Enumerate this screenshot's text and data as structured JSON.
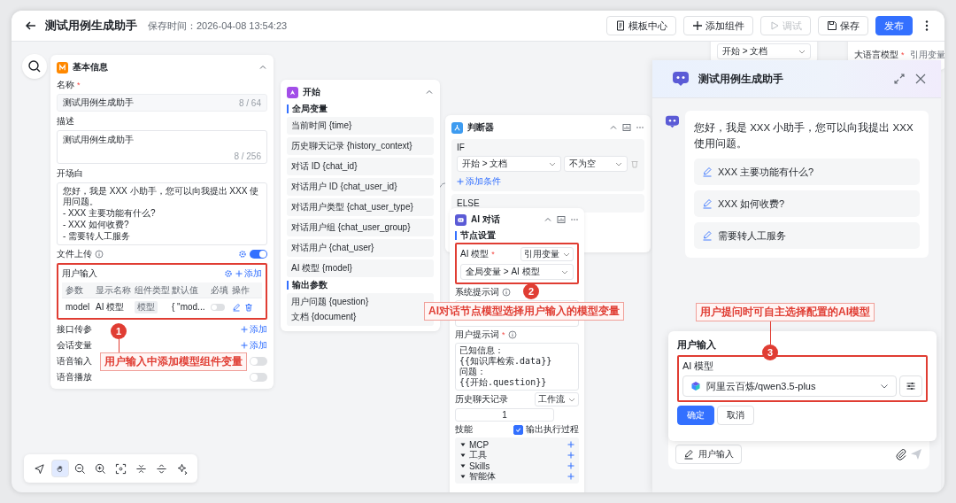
{
  "header": {
    "title": "测试用例生成助手",
    "save_time": "保存时间：2026-04-08 13:54:23",
    "buttons": [
      {
        "label": "模板中心",
        "kind": "default",
        "disabled": false
      },
      {
        "label": "添加组件",
        "kind": "default",
        "disabled": false
      },
      {
        "label": "调试",
        "kind": "default",
        "disabled": true
      },
      {
        "label": "保存",
        "kind": "default",
        "disabled": false
      },
      {
        "label": "发布",
        "kind": "primary",
        "disabled": false
      }
    ]
  },
  "base_info": {
    "title": "基本信息",
    "name": {
      "label": "名称",
      "required_mark": "*",
      "value": "测试用例生成助手",
      "count": "8 / 64"
    },
    "description": {
      "label": "描述",
      "value": "测试用例生成助手",
      "count": "8 / 256"
    },
    "opening": {
      "label": "开场白",
      "lines": [
        "您好，我是 XXX 小助手，您可以向我提出 XXX 使用问题。",
        "- XXX 主要功能有什么?",
        "- XXX 如何收费?",
        "- 需要转人工服务"
      ]
    },
    "file_upload": {
      "label": "文件上传",
      "on": true
    },
    "user_input": {
      "label": "用户输入",
      "add": "添加",
      "columns": [
        "参数",
        "显示名称",
        "组件类型",
        "默认值",
        "必填",
        "操作"
      ],
      "rows": [
        {
          "param": "model",
          "display_name": "AI 模型",
          "component_type": "模型",
          "default": "{ \"mod...",
          "required": false
        }
      ]
    },
    "settings": [
      {
        "kind": "add",
        "label": "接口传参",
        "action": "添加"
      },
      {
        "kind": "add",
        "label": "会话变量",
        "action": "添加"
      },
      {
        "kind": "toggle",
        "label": "语音输入",
        "on": false
      },
      {
        "kind": "toggle",
        "label": "语音播放",
        "on": false
      }
    ]
  },
  "start_node": {
    "title": "开始",
    "globals_label": "全局变量",
    "globals": [
      "当前时间 {time}",
      "历史聊天记录 {history_context}",
      "对话 ID {chat_id}",
      "对话用户 ID {chat_user_id}",
      "对话用户类型 {chat_user_type}",
      "对话用户组 {chat_user_group}",
      "对话用户 {chat_user}",
      "AI 模型 {model}"
    ],
    "outputs_label": "输出参数",
    "outputs": [
      "用户问题 {question}",
      "文档 {document}"
    ]
  },
  "judge_node": {
    "title": "判断器",
    "if_label": "IF",
    "field": "开始 > 文档",
    "operator": "不为空",
    "add_condition": "添加条件",
    "else_label": "ELSE"
  },
  "ai_node": {
    "title": "AI 对话",
    "section": "节点设置",
    "model_label": "AI 模型",
    "required_mark": "*",
    "model_mode": "引用变量",
    "model_value": "全局变量 > AI 模型",
    "system_prompt_label": "系统提示词",
    "user_prompt_label": "用户提示词",
    "user_prompt_lines": [
      "已知信息：",
      "{{知识库检索.data}}",
      "问题：",
      "{{开始.question}}"
    ],
    "history_label": "历史聊天记录",
    "history_mode": "工作流",
    "history_count": "1",
    "skills_label": "技能",
    "show_process": {
      "label": "输出执行过程",
      "checked": true
    },
    "skills": [
      "MCP",
      "工具",
      "Skills",
      "智能体"
    ]
  },
  "background_nodes": {
    "field": "开始 > 文档",
    "model_label": "大语言模型",
    "required_mark": "*",
    "model_mode": "引用变量"
  },
  "chat": {
    "title": "测试用例生成助手",
    "greeting": "您好，我是 XXX 小助手，您可以向我提出 XXX 使用问题。",
    "suggestions": [
      "XXX 主要功能有什么?",
      "XXX 如何收费?",
      "需要转人工服务"
    ],
    "popover": {
      "title": "用户输入",
      "field_label": "AI 模型",
      "model": "阿里云百炼/qwen3.5-plus",
      "confirm": "确定",
      "cancel": "取消"
    },
    "input_button": "用户输入"
  },
  "annotations": [
    {
      "number": "1",
      "text": "用户输入中添加模型组件变量"
    },
    {
      "number": "2",
      "text": "AI对话节点模型选择用户输入的模型变量"
    },
    {
      "number": "3",
      "text": "用户提问时可自主选择配置的AI模型"
    }
  ],
  "toolbar": {
    "tools": [
      {
        "selected": false
      },
      {
        "selected": true
      },
      {
        "selected": false
      },
      {
        "selected": false
      },
      {
        "selected": false
      },
      {
        "selected": false
      },
      {
        "selected": false
      },
      {
        "selected": false
      }
    ]
  }
}
